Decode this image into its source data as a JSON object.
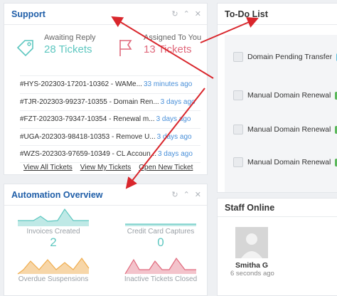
{
  "support": {
    "title": "Support",
    "awaiting_label": "Awaiting Reply",
    "awaiting_value": "28 Tickets",
    "assigned_label": "Assigned To You",
    "assigned_value": "13 Tickets",
    "tickets": [
      {
        "id": "#HYS-202303-17201-10362 - WAMe...",
        "time": "33 minutes ago"
      },
      {
        "id": "#TJR-202303-99237-10355 - Domain Ren...",
        "time": "3 days ago"
      },
      {
        "id": "#FZT-202303-79347-10354 - Renewal m...",
        "time": "3 days ago"
      },
      {
        "id": "#UGA-202303-98418-10353 - Remove U...",
        "time": "3 days ago"
      },
      {
        "id": "#WZS-202303-97659-10349 - CL Accoun...",
        "time": "3 days ago"
      }
    ],
    "links": [
      "View All Tickets",
      "View My Tickets",
      "Open New Ticket"
    ],
    "colors": {
      "awaiting": "#5ec7c0",
      "assigned": "#e0697c"
    }
  },
  "automation": {
    "title": "Automation Overview",
    "items": [
      {
        "label": "Invoices Created",
        "value": "2",
        "color": "#5ec7c0"
      },
      {
        "label": "Credit Card Captures",
        "value": "0",
        "color": "#5ec7c0"
      },
      {
        "label": "Overdue Suspensions",
        "value": "",
        "color": "#f0ad4e"
      },
      {
        "label": "Inactive Tickets Closed",
        "value": "",
        "color": "#e0697c"
      }
    ]
  },
  "todo": {
    "title": "To-Do List",
    "items": [
      {
        "label": "Domain Pending Transfer",
        "badge": ""
      },
      {
        "label": "Manual Domain Renewal",
        "badge": "P"
      },
      {
        "label": "Manual Domain Renewal",
        "badge": "P"
      },
      {
        "label": "Manual Domain Renewal",
        "badge": "P"
      }
    ]
  },
  "staff": {
    "title": "Staff Online",
    "name": "Smitha G",
    "time": "6 seconds ago"
  },
  "icons": {
    "refresh": "↻",
    "collapse": "⌃",
    "close": "✕"
  }
}
